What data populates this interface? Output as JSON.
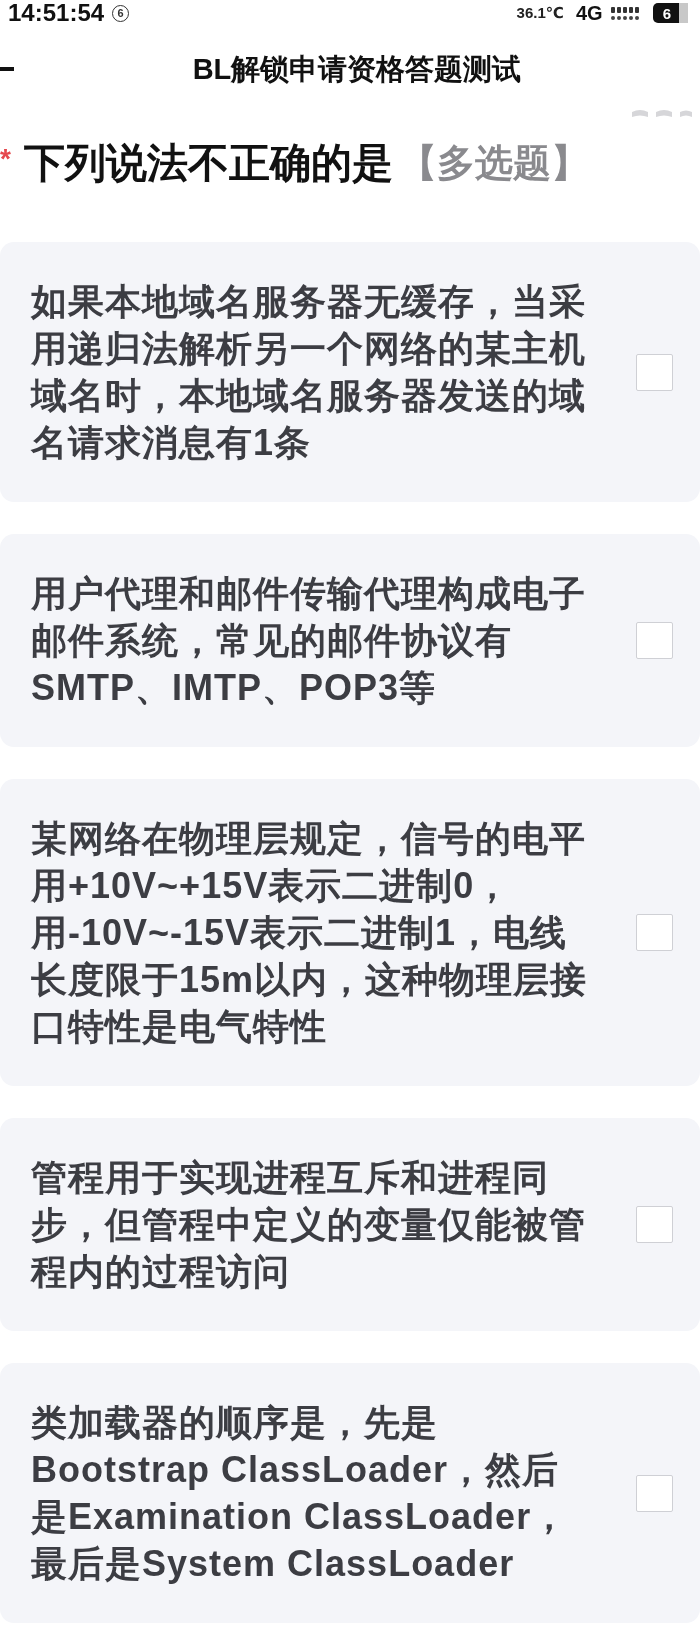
{
  "status_bar": {
    "time": "14:51:54",
    "badge": "6",
    "temperature": "36.1℃",
    "network": "4G",
    "battery": "6"
  },
  "header": {
    "title": "BL解锁申请资格答题测试"
  },
  "question": {
    "required_mark": "*",
    "text": "下列说法不正确的是",
    "type_label": "【多选题】"
  },
  "options": [
    {
      "text": "如果本地域名服务器无缓存，当采用递归法解析另一个网络的某主机域名时，本地域名服务器发送的域名请求消息有1条",
      "checked": false
    },
    {
      "text": "用户代理和邮件传输代理构成电子邮件系统，常见的邮件协议有SMTP、IMTP、POP3等",
      "checked": false
    },
    {
      "text": "某网络在物理层规定，信号的电平用+10V~+15V表示二进制0，用-10V~-15V表示二进制1，电线长度限于15m以内，这种物理层接口特性是电气特性",
      "checked": false
    },
    {
      "text": "管程用于实现进程互斥和进程同步，但管程中定义的变量仅能被管程内的过程访问",
      "checked": false
    },
    {
      "text": "类加载器的顺序是，先是Bootstrap ClassLoader，然后是Examination ClassLoader，最后是System ClassLoader",
      "checked": false
    }
  ]
}
